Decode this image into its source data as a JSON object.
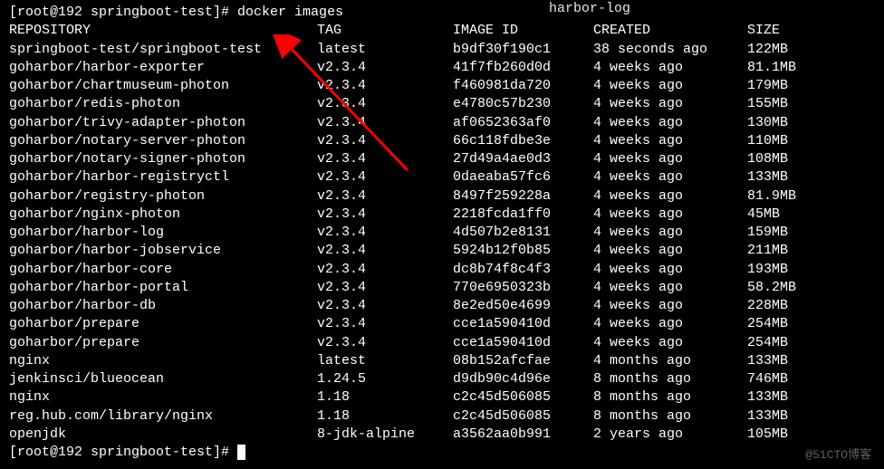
{
  "top_fragment": "harbor-log",
  "prompt1": "[root@192 springboot-test]# ",
  "command": "docker images",
  "headers": {
    "repository": "REPOSITORY",
    "tag": "TAG",
    "image_id": "IMAGE ID",
    "created": "CREATED",
    "size": "SIZE"
  },
  "rows": [
    {
      "repo": "springboot-test/springboot-test",
      "tag": "latest",
      "id": "b9df30f190c1",
      "created": "38 seconds ago",
      "size": "122MB"
    },
    {
      "repo": "goharbor/harbor-exporter",
      "tag": "v2.3.4",
      "id": "41f7fb260d0d",
      "created": "4 weeks ago",
      "size": "81.1MB"
    },
    {
      "repo": "goharbor/chartmuseum-photon",
      "tag": "v2.3.4",
      "id": "f460981da720",
      "created": "4 weeks ago",
      "size": "179MB"
    },
    {
      "repo": "goharbor/redis-photon",
      "tag": "v2.3.4",
      "id": "e4780c57b230",
      "created": "4 weeks ago",
      "size": "155MB"
    },
    {
      "repo": "goharbor/trivy-adapter-photon",
      "tag": "v2.3.4",
      "id": "af0652363af0",
      "created": "4 weeks ago",
      "size": "130MB"
    },
    {
      "repo": "goharbor/notary-server-photon",
      "tag": "v2.3.4",
      "id": "66c118fdbe3e",
      "created": "4 weeks ago",
      "size": "110MB"
    },
    {
      "repo": "goharbor/notary-signer-photon",
      "tag": "v2.3.4",
      "id": "27d49a4ae0d3",
      "created": "4 weeks ago",
      "size": "108MB"
    },
    {
      "repo": "goharbor/harbor-registryctl",
      "tag": "v2.3.4",
      "id": "0daeaba57fc6",
      "created": "4 weeks ago",
      "size": "133MB"
    },
    {
      "repo": "goharbor/registry-photon",
      "tag": "v2.3.4",
      "id": "8497f259228a",
      "created": "4 weeks ago",
      "size": "81.9MB"
    },
    {
      "repo": "goharbor/nginx-photon",
      "tag": "v2.3.4",
      "id": "2218fcda1ff0",
      "created": "4 weeks ago",
      "size": "45MB"
    },
    {
      "repo": "goharbor/harbor-log",
      "tag": "v2.3.4",
      "id": "4d507b2e8131",
      "created": "4 weeks ago",
      "size": "159MB"
    },
    {
      "repo": "goharbor/harbor-jobservice",
      "tag": "v2.3.4",
      "id": "5924b12f0b85",
      "created": "4 weeks ago",
      "size": "211MB"
    },
    {
      "repo": "goharbor/harbor-core",
      "tag": "v2.3.4",
      "id": "dc8b74f8c4f3",
      "created": "4 weeks ago",
      "size": "193MB"
    },
    {
      "repo": "goharbor/harbor-portal",
      "tag": "v2.3.4",
      "id": "770e6950323b",
      "created": "4 weeks ago",
      "size": "58.2MB"
    },
    {
      "repo": "goharbor/harbor-db",
      "tag": "v2.3.4",
      "id": "8e2ed50e4699",
      "created": "4 weeks ago",
      "size": "228MB"
    },
    {
      "repo": "goharbor/prepare",
      "tag": "v2.3.4",
      "id": "cce1a590410d",
      "created": "4 weeks ago",
      "size": "254MB"
    },
    {
      "repo": "goharbor/prepare",
      "tag": "v2.3.4",
      "id": "cce1a590410d",
      "created": "4 weeks ago",
      "size": "254MB"
    },
    {
      "repo": "nginx",
      "tag": "latest",
      "id": "08b152afcfae",
      "created": "4 months ago",
      "size": "133MB"
    },
    {
      "repo": "jenkinsci/blueocean",
      "tag": "1.24.5",
      "id": "d9db90c4d96e",
      "created": "8 months ago",
      "size": "746MB"
    },
    {
      "repo": "nginx",
      "tag": "1.18",
      "id": "c2c45d506085",
      "created": "8 months ago",
      "size": "133MB"
    },
    {
      "repo": "reg.hub.com/library/nginx",
      "tag": "1.18",
      "id": "c2c45d506085",
      "created": "8 months ago",
      "size": "133MB"
    },
    {
      "repo": "openjdk",
      "tag": "8-jdk-alpine",
      "id": "a3562aa0b991",
      "created": "2 years ago",
      "size": "105MB"
    }
  ],
  "prompt2": "[root@192 springboot-test]# ",
  "watermark": "@51CTO博客",
  "arrow_color": "#ff0000"
}
